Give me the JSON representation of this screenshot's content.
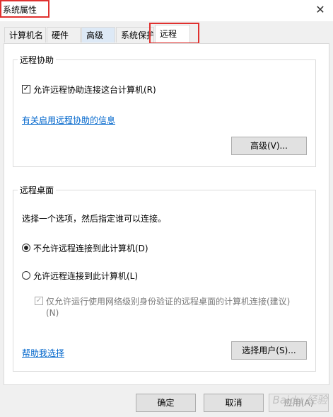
{
  "window": {
    "title": "系统属性",
    "close_glyph": "✕"
  },
  "tabs": [
    {
      "label": "计算机名"
    },
    {
      "label": "硬件"
    },
    {
      "label": "高级"
    },
    {
      "label": "系统保护"
    },
    {
      "label": "远程",
      "active": true
    }
  ],
  "remote_assistance": {
    "group_title": "远程协助",
    "allow_checkbox_label": "允许远程协助连接这台计算机(R)",
    "allow_checked": true,
    "info_link": "有关启用远程协助的信息",
    "advanced_button": "高级(V)..."
  },
  "remote_desktop": {
    "group_title": "远程桌面",
    "instruction": "选择一个选项，然后指定谁可以连接。",
    "option_deny": "不允许远程连接到此计算机(D)",
    "option_allow": "允许远程连接到此计算机(L)",
    "selected": "deny",
    "nla_line1": "仅允许运行使用网络级别身份验证的远程桌面的计算机连接(建议)",
    "nla_line2": "(N)",
    "nla_checked": true,
    "help_link": "帮助我选择",
    "select_users_button": "选择用户(S)..."
  },
  "footer": {
    "ok": "确定",
    "cancel": "取消",
    "apply": "应用(A)"
  },
  "watermark": "Baidu 经验",
  "colors": {
    "highlight_red": "#e0312f",
    "link_blue": "#0066cc"
  }
}
